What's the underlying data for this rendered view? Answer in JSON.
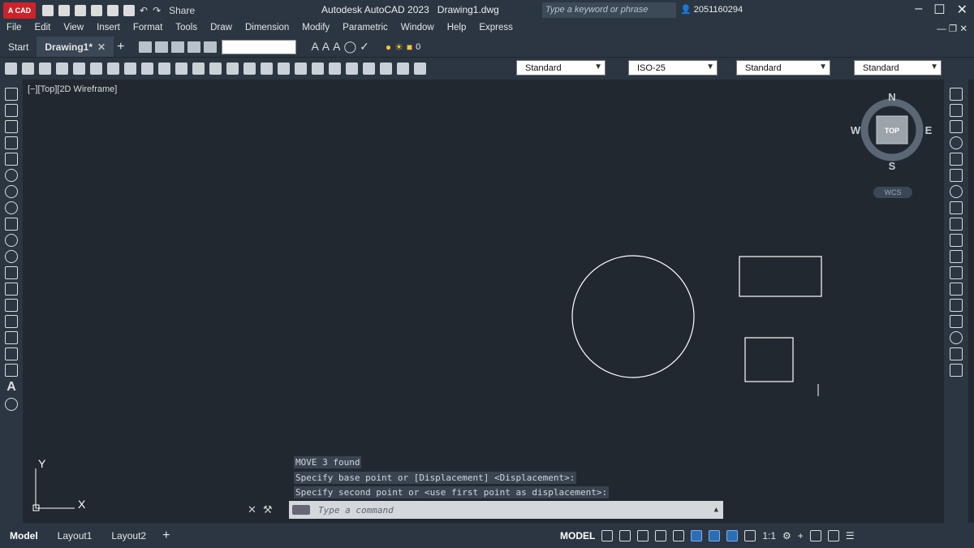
{
  "titlebar": {
    "logo_label": "A CAD",
    "share_label": "Share",
    "app_title": "Autodesk AutoCAD 2023",
    "file_name": "Drawing1.dwg",
    "search_placeholder": "Type a keyword or phrase",
    "user_id": "2051160294",
    "minimize_glyph": "‒",
    "maximize_glyph": "☐",
    "close_glyph": "✕"
  },
  "menu": {
    "items": [
      "File",
      "Edit",
      "View",
      "Insert",
      "Format",
      "Tools",
      "Draw",
      "Dimension",
      "Modify",
      "Parametric",
      "Window",
      "Help",
      "Express"
    ]
  },
  "tabs": {
    "start_label": "Start",
    "drawing_label": "Drawing1*",
    "close_glyph": "✕",
    "add_glyph": "+",
    "layer_value": "0"
  },
  "toolbar": {
    "text_style": "Standard",
    "dim_style": "ISO-25",
    "table_style": "Standard",
    "multileader_style": "Standard"
  },
  "viewport": {
    "label": "[−][Top][2D Wireframe]"
  },
  "viewcube": {
    "north": "N",
    "south": "S",
    "east": "E",
    "west": "W",
    "face": "TOP",
    "wcs_label": "WCS"
  },
  "ucs": {
    "x_label": "X",
    "y_label": "Y"
  },
  "command": {
    "history": [
      "MOVE 3 found",
      "Specify base point or [Displacement] <Displacement>:",
      "Specify second point or <use first point as displacement>:"
    ],
    "placeholder": "Type a command"
  },
  "statusbar": {
    "layout_tabs": [
      "Model",
      "Layout1",
      "Layout2"
    ],
    "add_glyph": "+",
    "model_label": "MODEL",
    "scale_label": "1:1"
  },
  "colors": {
    "canvas_bg": "#212830",
    "chrome_bg": "#2b3642",
    "geometry_stroke": "#ffffff"
  }
}
